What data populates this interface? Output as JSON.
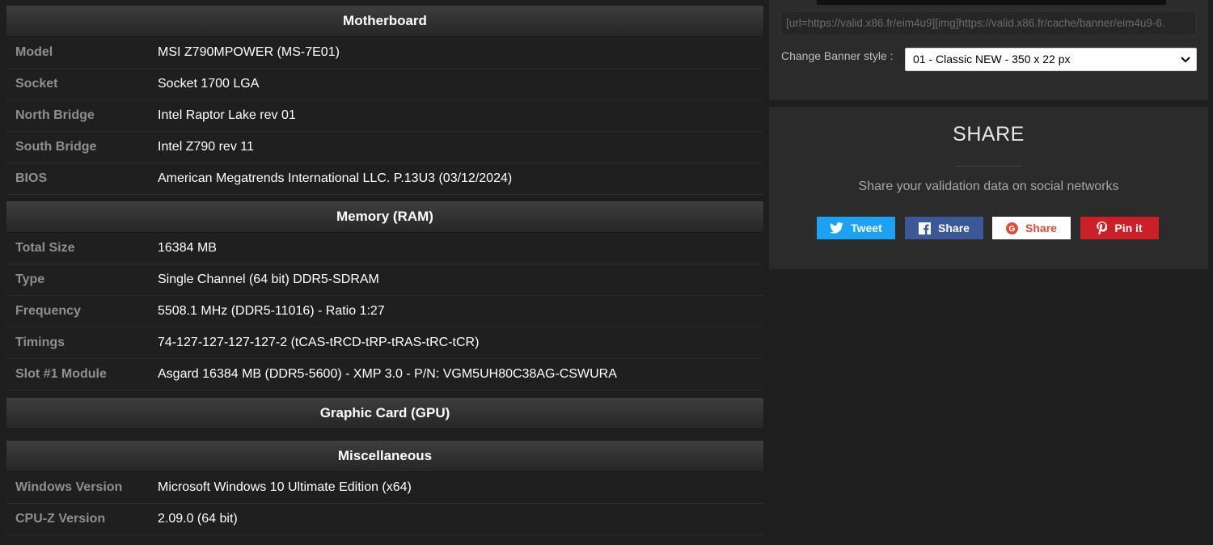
{
  "motherboard": {
    "title": "Motherboard",
    "rows": [
      {
        "label": "Model",
        "value": "MSI Z790MPOWER (MS-7E01)"
      },
      {
        "label": "Socket",
        "value": "Socket 1700 LGA"
      },
      {
        "label": "North Bridge",
        "value": "Intel Raptor Lake rev 01"
      },
      {
        "label": "South Bridge",
        "value": "Intel Z790 rev 11"
      },
      {
        "label": "BIOS",
        "value": "American Megatrends International LLC. P.13U3 (03/12/2024)"
      }
    ]
  },
  "memory": {
    "title": "Memory (RAM)",
    "rows": [
      {
        "label": "Total Size",
        "value": "16384 MB"
      },
      {
        "label": "Type",
        "value": "Single Channel (64 bit) DDR5-SDRAM"
      },
      {
        "label": "Frequency",
        "value": "5508.1 MHz (DDR5-11016) - Ratio 1:27"
      },
      {
        "label": "Timings",
        "value": "74-127-127-127-127-2 (tCAS-tRCD-tRP-tRAS-tRC-tCR)"
      },
      {
        "label": "Slot #1 Module",
        "value": "Asgard 16384 MB (DDR5-5600) - XMP 3.0 - P/N: VGM5UH80C38AG-CSWURA"
      }
    ]
  },
  "gpu": {
    "title": "Graphic Card (GPU)"
  },
  "misc": {
    "title": "Miscellaneous",
    "rows": [
      {
        "label": "Windows Version",
        "value": "Microsoft Windows 10 Ultimate Edition (x64)"
      },
      {
        "label": "CPU-Z Version",
        "value": "2.09.0 (64 bit)"
      }
    ]
  },
  "banner": {
    "code": "[url=https://valid.x86.fr/eim4u9][img]https://valid.x86.fr/cache/banner/eim4u9-6.",
    "style_label": "Change Banner style :",
    "style_selected": "01 - Classic NEW - 350 x 22 px"
  },
  "share": {
    "title": "SHARE",
    "description": "Share your validation data on social networks",
    "buttons": [
      {
        "label": "Tweet",
        "icon": "twitter-icon",
        "color": "#1da1f2"
      },
      {
        "label": "Share",
        "icon": "facebook-icon",
        "color": "#3b5998"
      },
      {
        "label": "Share",
        "icon": "google-plus-icon",
        "color": "#dd4b39"
      },
      {
        "label": "Pin it",
        "icon": "pinterest-icon",
        "color": "#cb2027"
      }
    ]
  }
}
